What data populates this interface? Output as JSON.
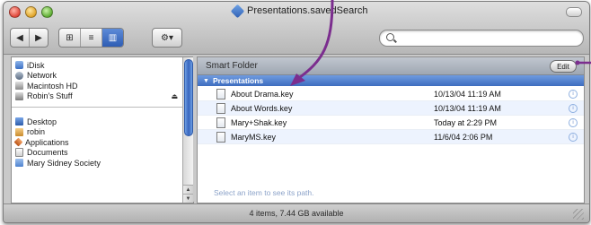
{
  "window": {
    "title": "Presentations.savedSearch"
  },
  "toolbar": {
    "nav": [
      {
        "icon": "back-arrow-icon",
        "glyph": "◀"
      },
      {
        "icon": "forward-arrow-icon",
        "glyph": "▶"
      }
    ],
    "views": [
      {
        "icon": "icon-view-icon",
        "glyph": "⊞"
      },
      {
        "icon": "list-view-icon",
        "glyph": "≡"
      },
      {
        "icon": "column-view-icon",
        "glyph": "▥"
      }
    ],
    "action": {
      "icon": "gear-icon",
      "glyph": "⚙▾"
    },
    "search": {
      "placeholder": "",
      "value": ""
    }
  },
  "sidebar": {
    "devices": [
      {
        "label": "iDisk",
        "icon": "idisk-icon"
      },
      {
        "label": "Network",
        "icon": "network-icon"
      },
      {
        "label": "Macintosh HD",
        "icon": "hard-drive-icon"
      },
      {
        "label": "Robin's Stuff",
        "icon": "drive-icon",
        "eject": "⏏"
      }
    ],
    "places": [
      {
        "label": "Desktop",
        "icon": "desktop-icon"
      },
      {
        "label": "robin",
        "icon": "home-icon"
      },
      {
        "label": "Applications",
        "icon": "applications-icon"
      },
      {
        "label": "Documents",
        "icon": "documents-icon"
      },
      {
        "label": "Mary Sidney Society",
        "icon": "folder-icon"
      }
    ]
  },
  "main": {
    "smart_folder_label": "Smart Folder",
    "edit_label": "Edit",
    "group_label": "Presentations",
    "files": [
      {
        "name": "About Drama.key",
        "date": "10/13/04 11:19 AM"
      },
      {
        "name": "About Words.key",
        "date": "10/13/04 11:19 AM"
      },
      {
        "name": "Mary+Shak.key",
        "date": "Today at 2:29 PM"
      },
      {
        "name": "MaryMS.key",
        "date": "11/6/04 2:06 PM"
      }
    ],
    "path_hint": "Select an item to see its path."
  },
  "status": {
    "text": "4 items, 7.44 GB available"
  },
  "colors": {
    "selection_blue": "#3e6dbf",
    "annotation_purple": "#7b2d8e"
  }
}
